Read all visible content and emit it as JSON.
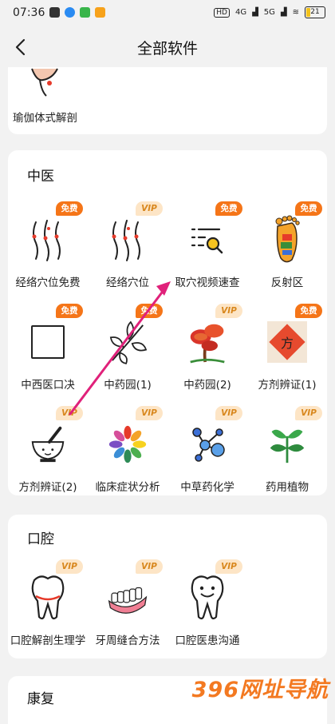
{
  "status": {
    "time": "07:36",
    "net1": "4G",
    "net2": "5G",
    "battery": "21"
  },
  "header": {
    "title": "全部软件"
  },
  "top_item": {
    "label": "瑜伽体式解剖"
  },
  "sections": {
    "tcm": {
      "title": "中医",
      "items": [
        {
          "label": "经络穴位免费",
          "badge": "免费",
          "icon": "meridian-figures-icon"
        },
        {
          "label": "经络穴位",
          "badge": "VIP",
          "icon": "meridian-figures-icon"
        },
        {
          "label": "取穴视频速查",
          "badge": "免费",
          "icon": "list-search-icon"
        },
        {
          "label": "反射区",
          "badge": "免费",
          "icon": "foot-reflexology-icon"
        },
        {
          "label": "中西医口决",
          "badge": "免费",
          "icon": "square-icon"
        },
        {
          "label": "中药园(1)",
          "badge": "免费",
          "icon": "leaf-branch-icon"
        },
        {
          "label": "中药园(2)",
          "badge": "VIP",
          "icon": "mushroom-icon"
        },
        {
          "label": "方剂辨证(1)",
          "badge": "免费",
          "icon": "prescription-stamp-icon",
          "stamp": "方"
        },
        {
          "label": "方剂辨证(2)",
          "badge": "VIP",
          "icon": "mortar-pestle-icon"
        },
        {
          "label": "临床症状分析",
          "badge": "VIP",
          "icon": "color-wheel-icon"
        },
        {
          "label": "中草药化学",
          "badge": "VIP",
          "icon": "molecule-icon"
        },
        {
          "label": "药用植物",
          "badge": "VIP",
          "icon": "plant-sprout-icon"
        }
      ]
    },
    "dental": {
      "title": "口腔",
      "items": [
        {
          "label": "口腔解剖生理学",
          "badge": "VIP",
          "icon": "tooth-icon"
        },
        {
          "label": "牙周缝合方法",
          "badge": "VIP",
          "icon": "denture-icon"
        },
        {
          "label": "口腔医患沟通",
          "badge": "VIP",
          "icon": "smiling-tooth-icon"
        }
      ]
    },
    "rehab": {
      "title": "康复"
    }
  },
  "watermark": "396网址导航",
  "colors": {
    "free_badge": "#f57518",
    "vip_badge_bg": "#fde5c6",
    "vip_badge_text": "#d8871d",
    "arrow": "#e0217a"
  }
}
